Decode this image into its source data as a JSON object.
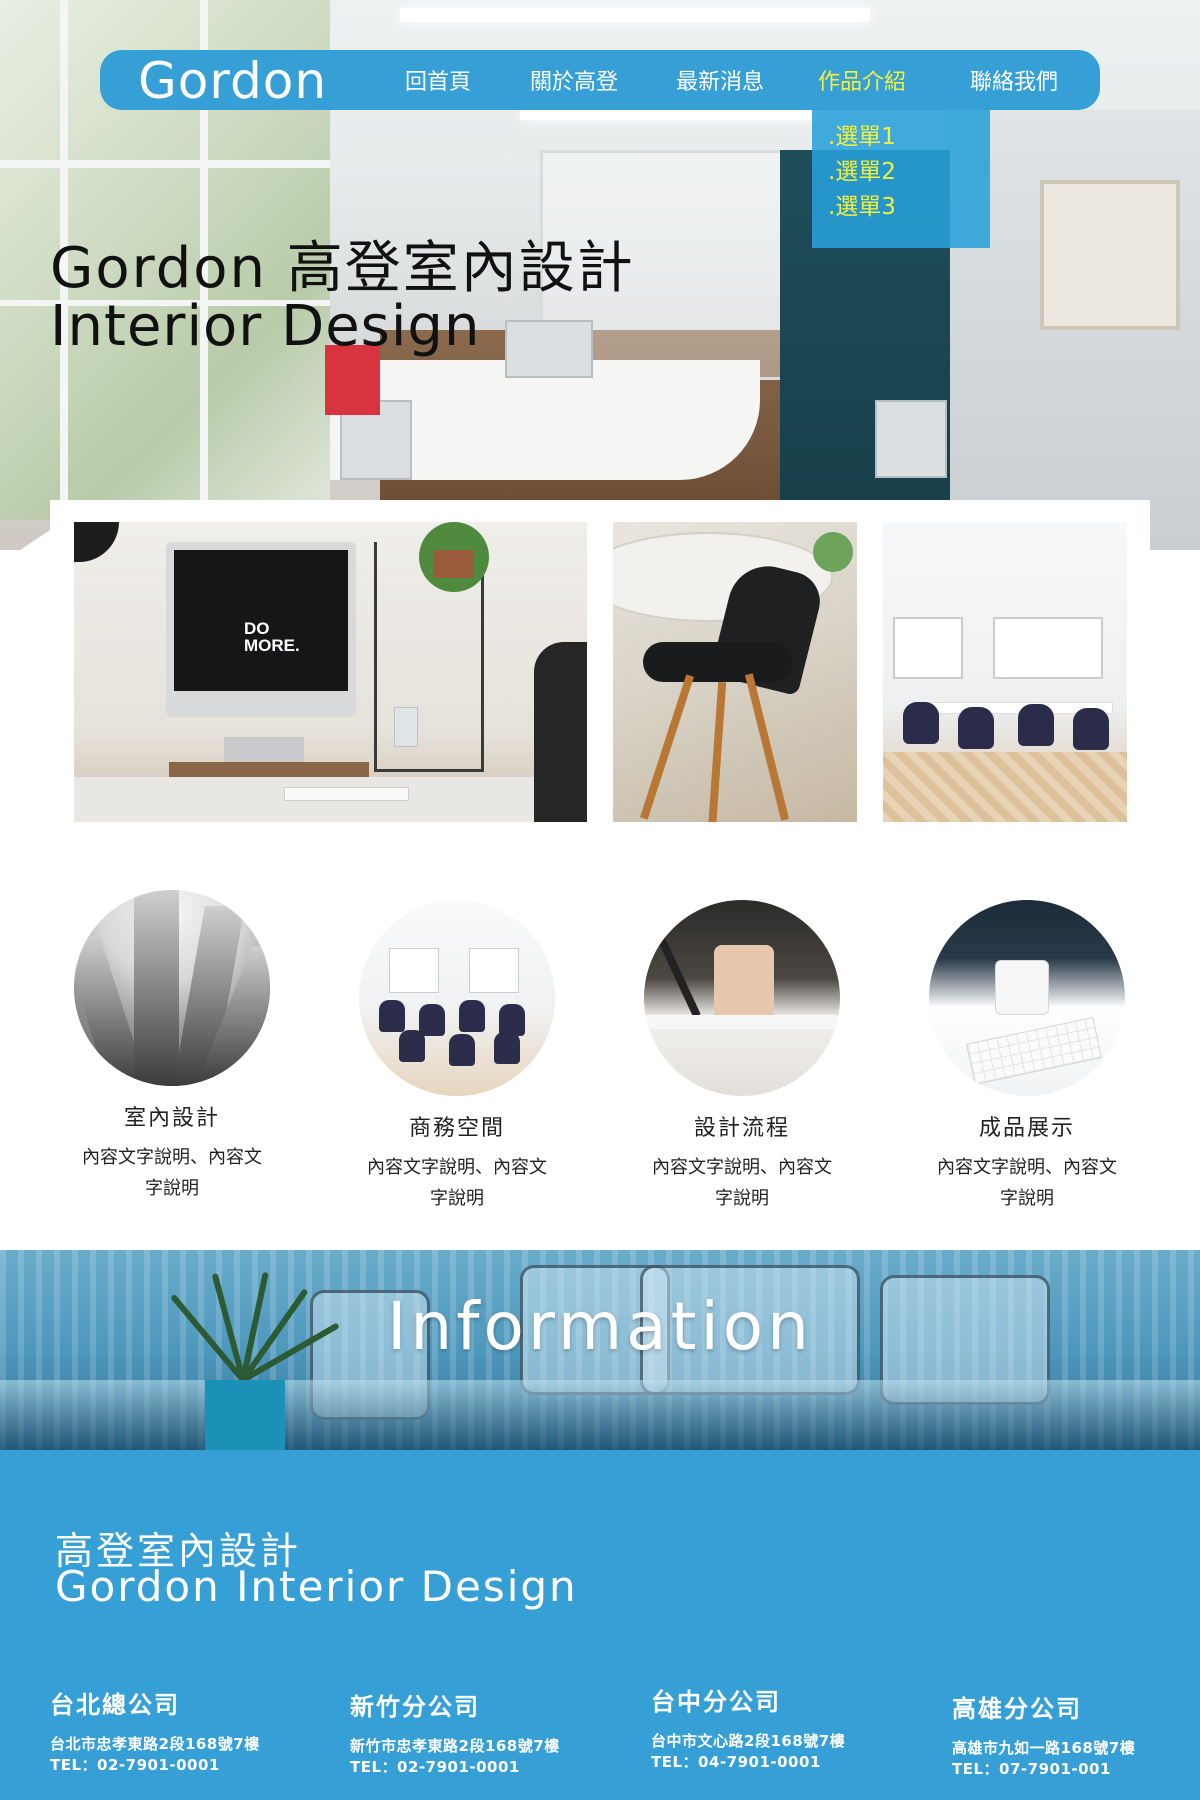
{
  "brand": {
    "logo": "Gordon",
    "accent_color": "#36a0d6",
    "highlight_color": "#f4ef3d"
  },
  "nav": {
    "items": [
      {
        "label": "回首頁",
        "active": false
      },
      {
        "label": "關於高登",
        "active": false
      },
      {
        "label": "最新消息",
        "active": false
      },
      {
        "label": "作品介紹",
        "active": true
      },
      {
        "label": "聯絡我們",
        "active": false
      }
    ],
    "dropdown": [
      ".選單1",
      ".選單2",
      ".選單3"
    ]
  },
  "hero": {
    "title_line1": "Gordon 高登室內設計",
    "title_line2": "Interior Design"
  },
  "gallery": {
    "photo1_screen_text": [
      "DO",
      "MORE."
    ]
  },
  "services": [
    {
      "title": "室內設計",
      "desc": "內容文字說明、內容文字說明",
      "icon": "skyscraper-photo"
    },
    {
      "title": "商務空間",
      "desc": "內容文字說明、內容文字說明",
      "icon": "meeting-room-photo"
    },
    {
      "title": "設計流程",
      "desc": "內容文字說明、內容文字說明",
      "icon": "design-desk-photo"
    },
    {
      "title": "成品展示",
      "desc": "內容文字說明、內容文字說明",
      "icon": "workspace-photo"
    }
  ],
  "information": {
    "title": "Information"
  },
  "footer": {
    "company_zh": "高登室內設計",
    "company_en": "Gordon Interior Design",
    "branches": [
      {
        "name": "台北總公司",
        "address": "台北市忠孝東路2段168號7樓",
        "tel": "TEL：02-7901-0001"
      },
      {
        "name": "新竹分公司",
        "address": "新竹市忠孝東路2段168號7樓",
        "tel": "TEL：02-7901-0001"
      },
      {
        "name": "台中分公司",
        "address": "台中市文心路2段168號7樓",
        "tel": "TEL：04-7901-0001"
      },
      {
        "name": "高雄分公司",
        "address": "高雄市九如一路168號7樓",
        "tel": "TEL：07-7901-001"
      }
    ]
  }
}
